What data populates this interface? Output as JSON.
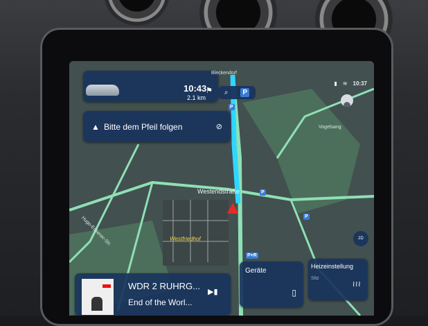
{
  "status": {
    "clock": "10:37"
  },
  "route": {
    "eta": "10:43",
    "distance": "2.1 km"
  },
  "guidance": {
    "instruction": "Bitte dem Pfeil folgen"
  },
  "search": {
    "parking": "P"
  },
  "map": {
    "labels": {
      "top": "Bleckendorf",
      "westendstrasse": "Westendstraße",
      "westfriedhof": "Westfriedhof",
      "hugo": "Hugo-Eckener-Str.",
      "vogelsang": "Vogelsang"
    },
    "poi_p": "P",
    "poi_pr": "P+R"
  },
  "media": {
    "title": "WDR 2 RUHRG...",
    "subtitle": "End of the Worl..."
  },
  "devices": {
    "label": "Geräte"
  },
  "climate": {
    "label": "Heizeinstellung",
    "sub": "Sitz"
  },
  "compass": {
    "text": "2D"
  }
}
